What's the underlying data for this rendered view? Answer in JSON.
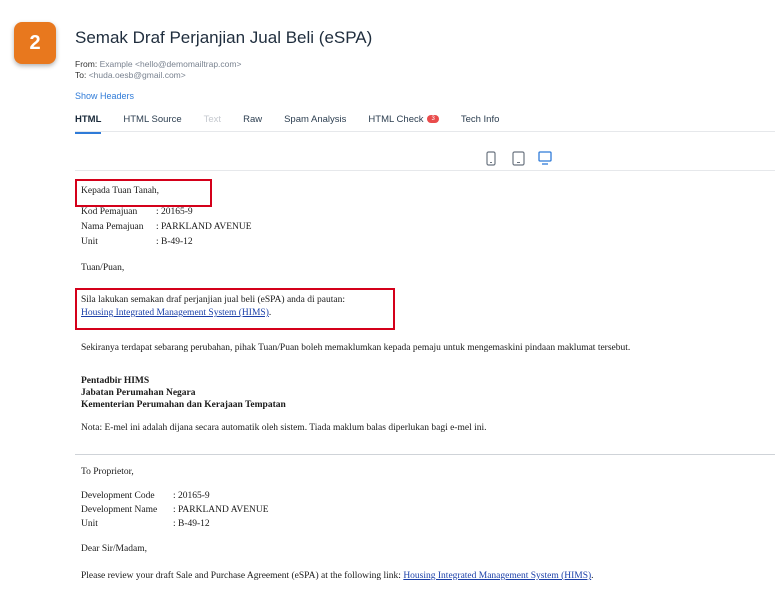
{
  "step": "2",
  "subject": "Semak Draf Perjanjian Jual Beli (eSPA)",
  "from_label": "From:",
  "from_value": "Example <hello@demomailtrap.com>",
  "to_label": "To:",
  "to_value": "<huda.oesb@gmail.com>",
  "show_headers": "Show Headers",
  "tabs": {
    "html": "HTML",
    "html_source": "HTML Source",
    "text": "Text",
    "raw": "Raw",
    "spam": "Spam Analysis",
    "html_check": "HTML Check",
    "html_check_badge": "3",
    "tech": "Tech Info"
  },
  "colors": {
    "accent": "#2f7bd8",
    "highlight": "#d4001a",
    "badge": "#e8781e"
  },
  "view_icons": [
    "mobile-view-icon",
    "tablet-view-icon",
    "desktop-view-icon"
  ],
  "email": {
    "greeting_ms": "Kepada Tuan Tanah,",
    "kod_label": "Kod Pemajuan",
    "kod_value": ": 20165-9",
    "nama_label": "Nama Pemajuan",
    "nama_value": ": PARKLAND AVENUE",
    "unit_label": "Unit",
    "unit_value": ": B-49-12",
    "salutation_ms": "Tuan/Puan,",
    "body_ms": "Sila lakukan semakan draf perjanjian jual beli (eSPA) anda di pautan:",
    "link_ms": "Housing Integrated Management System (HIMS)",
    "link_ms_suffix": ".",
    "note_ms": "Sekiranya terdapat sebarang perubahan, pihak Tuan/Puan boleh memaklumkan kepada pemaju untuk mengemaskini pindaan maklumat tersebut.",
    "sig1": "Pentadbir HIMS",
    "sig2": "Jabatan Perumahan Negara",
    "sig3": "Kementerian Perumahan dan Kerajaan Tempatan",
    "auto_note": "Nota: E-mel ini adalah dijana secara automatik oleh sistem. Tiada maklum balas diperlukan bagi e-mel ini.",
    "greeting_en": "To Proprietor,",
    "dev_code_label": "Development Code",
    "dev_code_value": ": 20165-9",
    "dev_name_label": "Development Name",
    "dev_name_value": ": PARKLAND AVENUE",
    "unit_label_en": "Unit",
    "unit_value_en": ": B-49-12",
    "salutation_en": "Dear Sir/Madam,",
    "body_en": "Please review your draft Sale and Purchase Agreement (eSPA) at the following link:",
    "link_en": "Housing Integrated Management System (HIMS)",
    "link_en_suffix": "."
  }
}
